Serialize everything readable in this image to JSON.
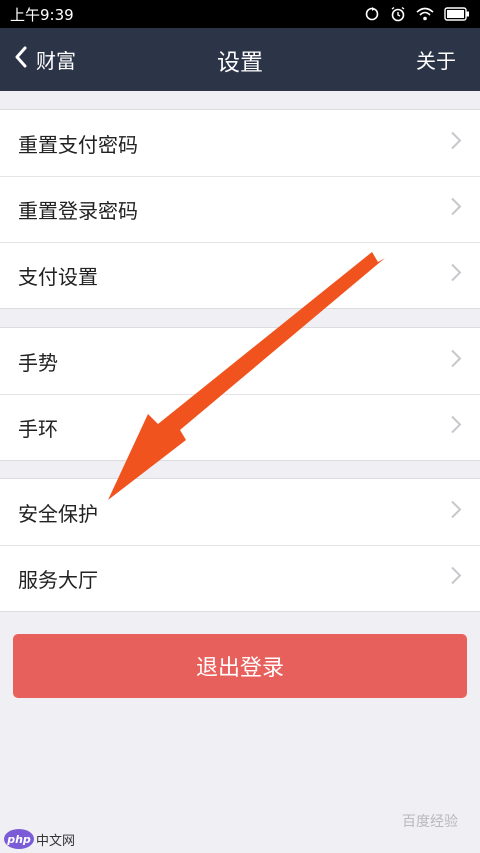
{
  "status_bar": {
    "time": "上午9:39",
    "icons": [
      "sync-icon",
      "alarm-icon",
      "wifi-icon",
      "battery-icon"
    ]
  },
  "nav": {
    "back_label": "财富",
    "title": "设置",
    "about_label": "关于"
  },
  "groups": [
    {
      "items": [
        {
          "label": "重置支付密码"
        },
        {
          "label": "重置登录密码"
        },
        {
          "label": "支付设置"
        }
      ]
    },
    {
      "items": [
        {
          "label": "手势"
        },
        {
          "label": "手环"
        }
      ]
    },
    {
      "items": [
        {
          "label": "安全保护"
        },
        {
          "label": "服务大厅"
        }
      ]
    }
  ],
  "logout_label": "退出登录",
  "watermarks": {
    "left_badge": "php",
    "left_text": "中文网",
    "right_text": "百度经验"
  },
  "colors": {
    "nav_background": "#2c3447",
    "logout_button": "#e8605c",
    "annotation_arrow": "#f0531e",
    "page_background": "#efeff4"
  }
}
